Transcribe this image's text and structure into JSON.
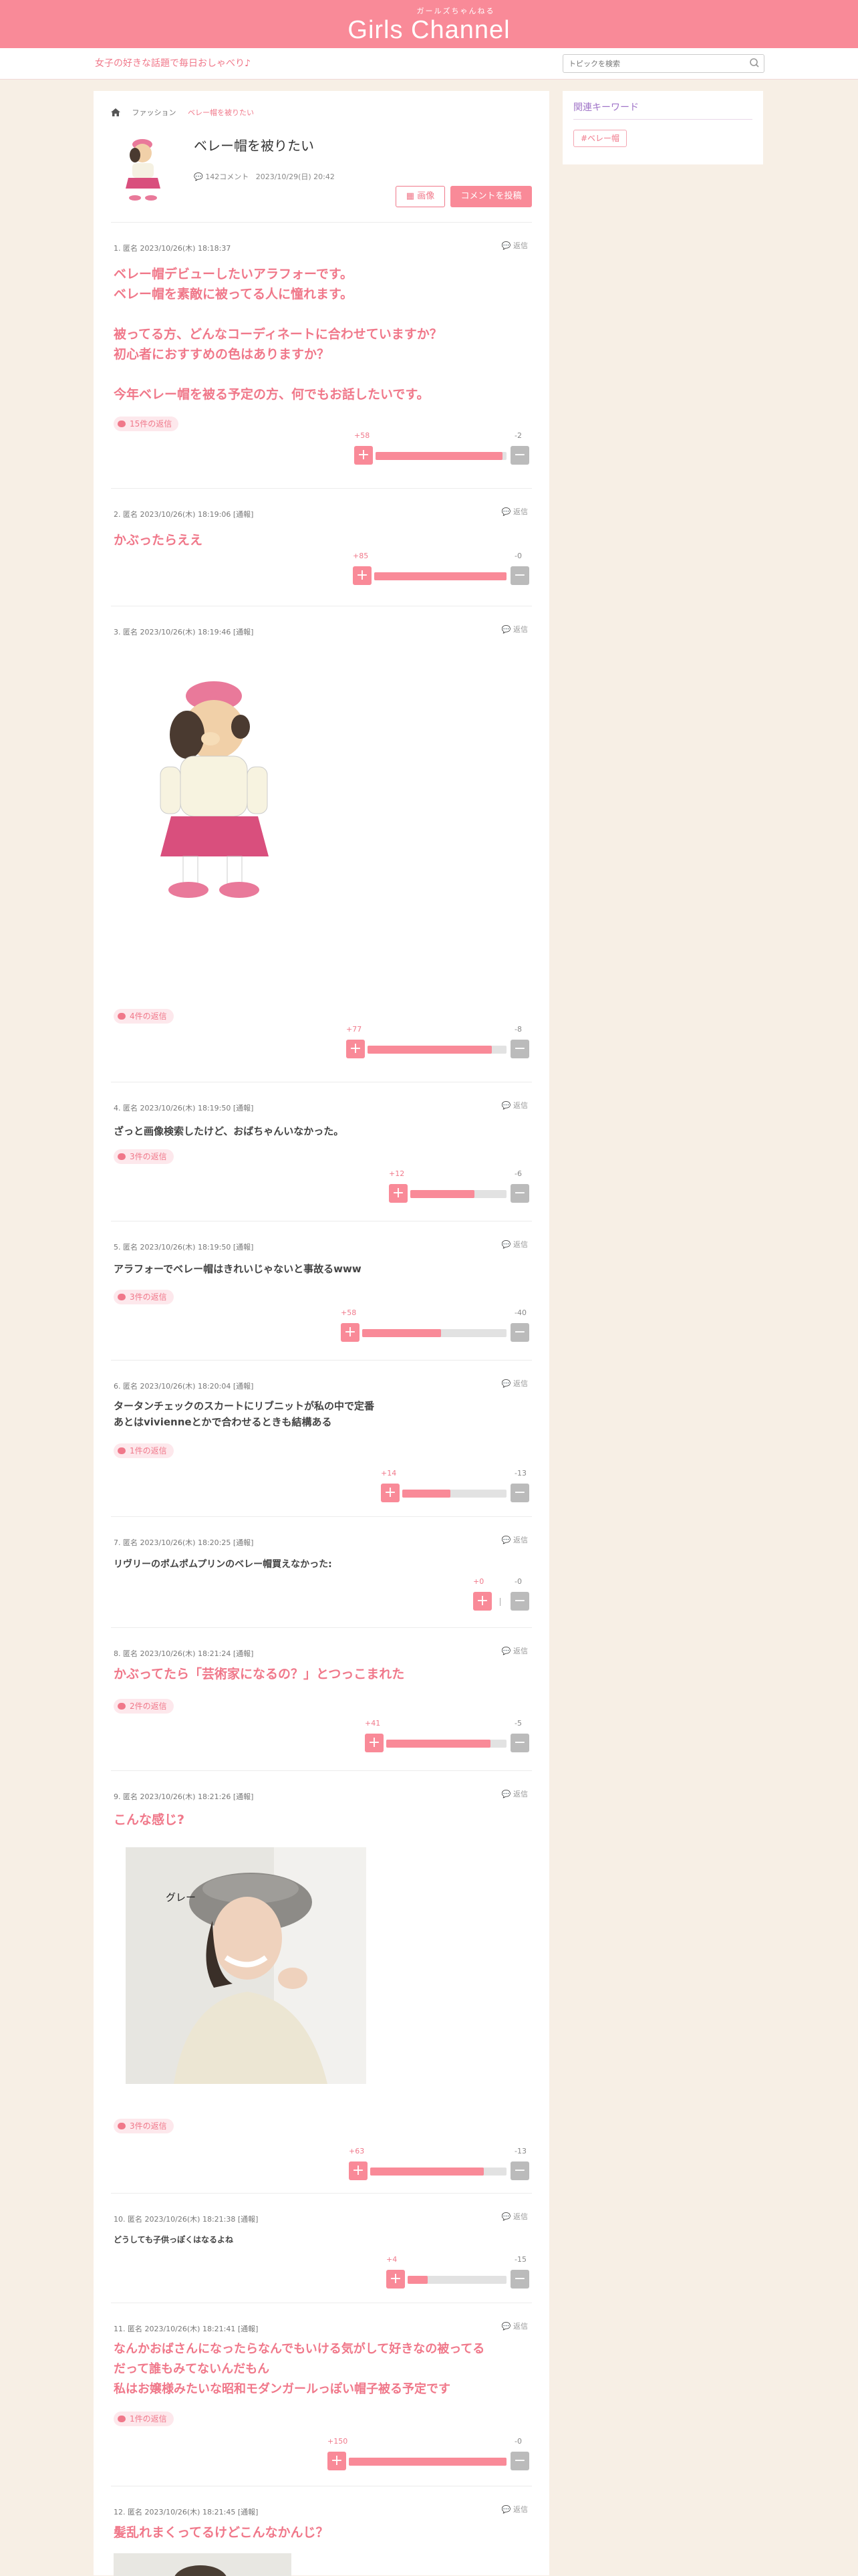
{
  "site": {
    "logo_small": "ガールズちゃんねる",
    "logo": "Girls Channel",
    "tagline": "女子の好きな話題で毎日おしゃべり♪",
    "search_placeholder": "トピックを検索"
  },
  "breadcrumb": [
    "ファッション",
    "ベレー帽を被りたい"
  ],
  "topic": {
    "title": "ベレー帽を被りたい",
    "comments": "142コメント",
    "date": "2023/10/29(日) 20:42",
    "image_button": "画像",
    "post_button": "コメントを投稿"
  },
  "sidebar": {
    "title": "関連キーワード",
    "keyword": "#ベレー帽"
  },
  "reply_label": "返信",
  "comments": [
    {
      "meta": "1. 匿名 2023/10/26(木) 18:18:37",
      "lines": [
        "ベレー帽デビューしたいアラフォーです。",
        "ベレー帽を素敵に被ってる人に憧れます。",
        "",
        "被ってる方、どんなコーディネートに合わせていますか？",
        "初心者におすすめの色はありますか？",
        "",
        "今年ベレー帽を被る予定の方、何でもお話したいです。"
      ],
      "replies": "15件の返信",
      "plus": "+58",
      "minus": "-2",
      "ratio": 0.97
    },
    {
      "meta": "2. 匿名 2023/10/26(木) 18:19:06 [通報]",
      "lines": [
        "かぶったらええ"
      ],
      "replies": "",
      "plus": "+85",
      "minus": "-0",
      "ratio": 1.0
    },
    {
      "meta": "3. 匿名 2023/10/26(木) 18:19:46 [通報]",
      "lines": [],
      "replies": "4件の返信",
      "plus": "+77",
      "minus": "-8",
      "ratio": 0.91
    },
    {
      "meta": "4. 匿名 2023/10/26(木) 18:19:50 [通報]",
      "lines": [
        "ざっと画像検索したけど、おばちゃんいなかった。"
      ],
      "replies": "3件の返信",
      "plus": "+12",
      "minus": "-6",
      "ratio": 0.67
    },
    {
      "meta": "5. 匿名 2023/10/26(木) 18:19:50 [通報]",
      "lines": [
        "アラフォーでベレー帽はきれいじゃないと事故るwww"
      ],
      "replies": "3件の返信",
      "plus": "+58",
      "minus": "-40",
      "ratio": 0.59
    },
    {
      "meta": "6. 匿名 2023/10/26(木) 18:20:04 [通報]",
      "lines": [
        "タータンチェックのスカートにリブニットが私の中で定番",
        "あとはvivienneとかで合わせるときも結構ある"
      ],
      "replies": "1件の返信",
      "plus": "+14",
      "minus": "-13",
      "ratio": 0.52
    },
    {
      "meta": "7. 匿名 2023/10/26(木) 18:20:25 [通報]",
      "lines": [
        "リヴリーのポムポムプリンのベレー帽買えなかった:"
      ],
      "replies": "",
      "plus": "+0",
      "minus": "-0",
      "ratio": 0.0
    },
    {
      "meta": "8. 匿名 2023/10/26(木) 18:21:24 [通報]",
      "lines": [
        "かぶってたら「芸術家になるの？」とつっこまれた"
      ],
      "replies": "2件の返信",
      "plus": "+41",
      "minus": "-5",
      "ratio": 0.89
    },
    {
      "meta": "9. 匿名 2023/10/26(木) 18:21:26 [通報]",
      "lines": [
        "こんな感じ?"
      ],
      "replies": "3件の返信",
      "plus": "+63",
      "minus": "-13",
      "ratio": 0.83,
      "photo_label": "グレー"
    },
    {
      "meta": "10. 匿名 2023/10/26(木) 18:21:38 [通報]",
      "lines": [
        "どうしても子供っぽくはなるよね"
      ],
      "replies": "",
      "plus": "+4",
      "minus": "-15",
      "ratio": 0.21
    },
    {
      "meta": "11. 匿名 2023/10/26(木) 18:21:41 [通報]",
      "lines": [
        "なんかおばさんになったらなんでもいける気がして好きなの被ってる",
        "だって誰もみてないんだもん",
        "私はお嬢様みたいな昭和モダンガールっぽい帽子被る予定です"
      ],
      "replies": "1件の返信",
      "plus": "+150",
      "minus": "-0",
      "ratio": 1.0
    },
    {
      "meta": "12. 匿名 2023/10/26(木) 18:21:45 [通報]",
      "lines": [
        "髪乱れまくってるけどこんなかんじ？"
      ],
      "replies": "",
      "plus": "",
      "minus": "",
      "ratio": 0
    }
  ],
  "colors": {
    "brand": "#f98a98",
    "accent_text": "#f0788a",
    "sidebar_title": "#a074c8",
    "background": "#f7efe5"
  }
}
